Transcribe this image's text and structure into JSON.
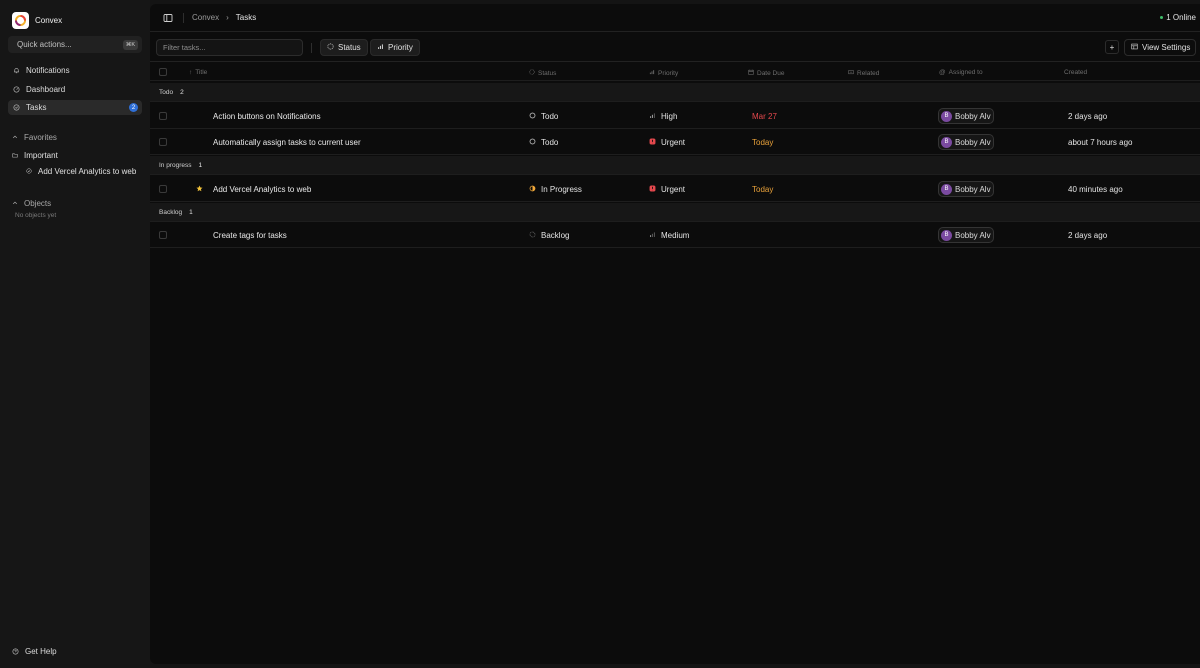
{
  "app": {
    "name": "Convex"
  },
  "sidebar": {
    "quick_actions": {
      "label": "Quick actions...",
      "shortcut": "⌘K"
    },
    "nav": [
      {
        "label": "Notifications",
        "icon": "bell-icon"
      },
      {
        "label": "Dashboard",
        "icon": "dashboard-icon"
      },
      {
        "label": "Tasks",
        "icon": "tasks-icon",
        "badge": "2",
        "active": true
      }
    ],
    "favorites": {
      "label": "Favorites",
      "folder": "Important",
      "items": [
        "Add Vercel Analytics to web"
      ]
    },
    "objects": {
      "label": "Objects",
      "empty": "No objects yet"
    },
    "help": "Get Help"
  },
  "header": {
    "breadcrumb": [
      "Convex",
      "Tasks"
    ],
    "online": "1 Online"
  },
  "toolbar": {
    "filter_placeholder": "Filter tasks...",
    "status_label": "Status",
    "priority_label": "Priority",
    "add_label": "+",
    "view_settings_label": "View Settings"
  },
  "table": {
    "columns": [
      "Title",
      "Status",
      "Priority",
      "Date Due",
      "Related",
      "Assigned to",
      "Created"
    ],
    "groups": [
      {
        "name": "Todo",
        "count": "2",
        "rows": [
          {
            "title": "Action buttons on Notifications",
            "status": "Todo",
            "priority": "High",
            "due": "Mar 27",
            "assignee": "Bobby Alv",
            "initial": "B",
            "created": "2 days ago"
          },
          {
            "title": "Automatically assign tasks to current user",
            "status": "Todo",
            "priority": "Urgent",
            "due": "Today",
            "assignee": "Bobby Alv",
            "initial": "B",
            "created": "about 7 hours ago"
          }
        ]
      },
      {
        "name": "In progress",
        "count": "1",
        "rows": [
          {
            "title": "Add Vercel Analytics to web",
            "status": "In Progress",
            "priority": "Urgent",
            "due": "Today",
            "assignee": "Bobby Alv",
            "initial": "B",
            "created": "40 minutes ago",
            "starred": true
          }
        ]
      },
      {
        "name": "Backlog",
        "count": "1",
        "rows": [
          {
            "title": "Create tags for tasks",
            "status": "Backlog",
            "priority": "Medium",
            "due": "",
            "assignee": "Bobby Alv",
            "initial": "B",
            "created": "2 days ago"
          }
        ]
      }
    ]
  },
  "colors": {
    "accent": "#2f6fd6",
    "urgent": "#e5484d",
    "overdue": "#e5484d",
    "today": "#e8a13a",
    "star": "#f2c23a",
    "avatar": "#7a4aa0",
    "online": "#3fbf6a"
  }
}
